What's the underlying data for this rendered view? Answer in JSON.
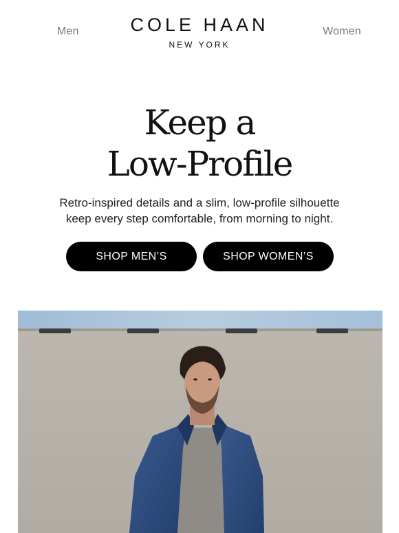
{
  "header": {
    "nav_left": "Men",
    "nav_right": "Women",
    "logo_main": "COLE HAAN",
    "logo_sub": "NEW YORK"
  },
  "hero_text": {
    "headline_line1": "Keep a",
    "headline_line2": "Low-Profile",
    "body_line1": "Retro-inspired details and a slim, low-profile silhouette",
    "body_line2": "keep every step comfortable, from morning to night."
  },
  "buttons": {
    "shop_men": "SHOP MEN’S",
    "shop_women": "SHOP WOMEN’S"
  },
  "hero_image": {
    "icon": "man-in-denim-jacket-photo",
    "colors": {
      "sky": "#a9c4dc",
      "wall": "#b9b5ad",
      "jacket": "#2f4e82",
      "shirt": "#8f8c88",
      "hair": "#2a1f18",
      "skin": "#c89a80"
    }
  }
}
